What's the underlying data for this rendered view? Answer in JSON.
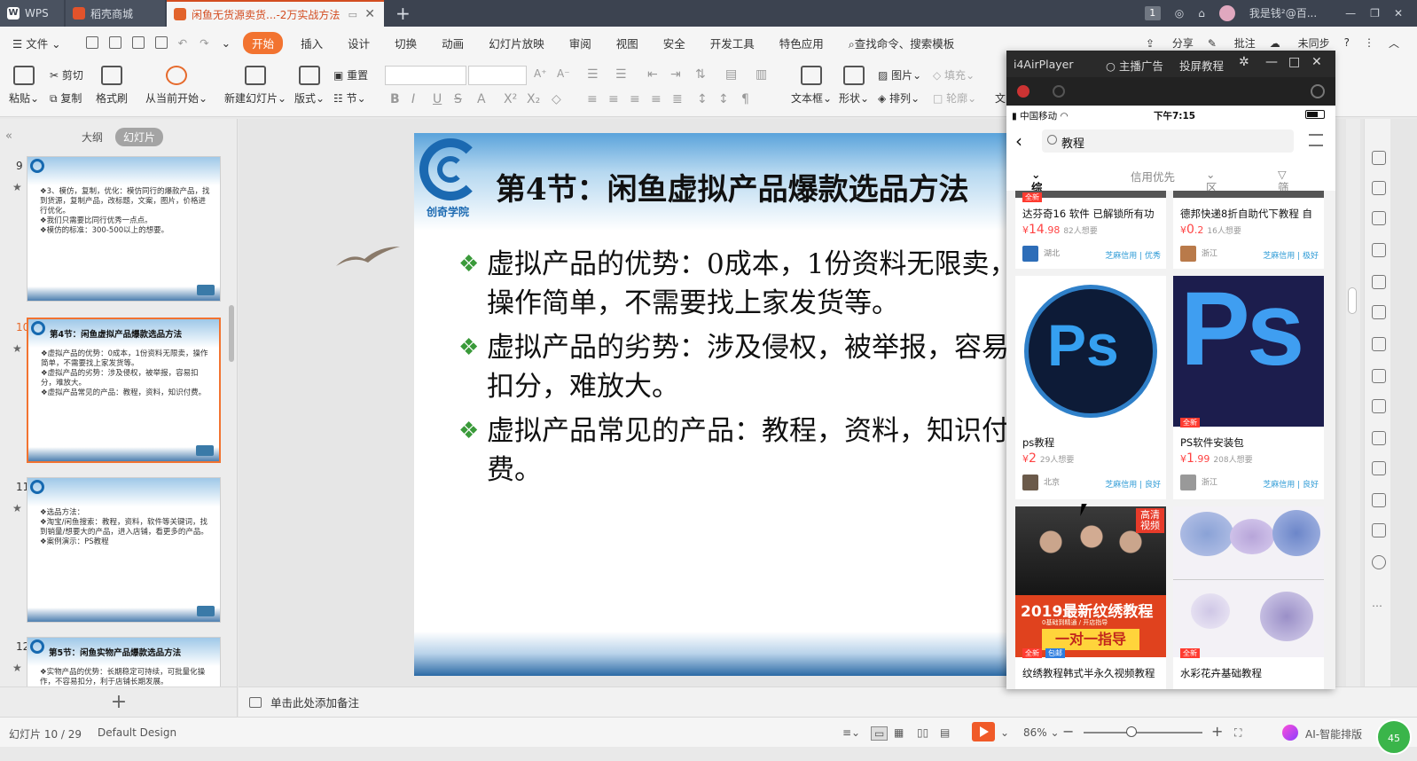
{
  "tabs": {
    "wps": "WPS",
    "store": "稻壳商城",
    "doc": "闲鱼无货源卖货...-2万实战方法",
    "count": "1",
    "user": "我是钱²@百..."
  },
  "menu": {
    "file": "文件",
    "items": [
      "开始",
      "插入",
      "设计",
      "切换",
      "动画",
      "幻灯片放映",
      "审阅",
      "视图",
      "安全",
      "开发工具",
      "特色应用"
    ],
    "search": "查找命令、搜索模板",
    "share": "分享",
    "annotate": "批注",
    "sync": "未同步"
  },
  "ribbon": {
    "paste": "粘贴",
    "cut": "剪切",
    "copy": "复制",
    "format_brush": "格式刷",
    "from_current": "从当前开始",
    "new_slide": "新建幻灯片",
    "layout": "版式",
    "reset": "重置",
    "section": "节",
    "textbox": "文本框",
    "shape": "形状",
    "picture": "图片",
    "arrange": "排列",
    "fill": "填充",
    "outline": "轮廓",
    "text_label": "文"
  },
  "left_panel": {
    "tab_outline": "大纲",
    "tab_slides": "幻灯片",
    "thumbs": [
      {
        "num": "9",
        "title": "",
        "lines": [
          "❖3、模仿，复制，优化：模仿同行的爆款产品，找到货源，复制产品，改标题，文案，图片，价格进行优化。",
          "❖我们只需要比同行优秀一点点。",
          "❖模仿的标准：300-500以上的想要。"
        ]
      },
      {
        "num": "10",
        "title": "第4节：闲鱼虚拟产品爆款选品方法",
        "lines": [
          "❖虚拟产品的优势：0成本，1份资料无限卖，操作简单，不需要找上家发货等。",
          "❖虚拟产品的劣势：涉及侵权，被举报，容易扣分，难放大。",
          "❖虚拟产品常见的产品：教程，资料，知识付费。"
        ]
      },
      {
        "num": "11",
        "title": "",
        "lines": [
          "❖选品方法：",
          "❖淘宝/闲鱼搜索：教程，资料，软件等关键词，找到销量/想要大的产品，进入店铺，看更多的产品。",
          "❖案例演示：PS教程"
        ]
      },
      {
        "num": "12",
        "title": "第5节：闲鱼实物产品爆款选品方法",
        "lines": [
          "❖实物产品的优势：长期稳定可持续，可批量化操作，不容易扣分，利于店铺长期发展。"
        ]
      }
    ]
  },
  "slide": {
    "logo_text": "创奇学院",
    "title": "第4节：闲鱼虚拟产品爆款选品方法",
    "bullets": [
      "虚拟产品的优势：0成本，1份资料无限卖，操作简单，不需要找上家发货等。",
      "虚拟产品的劣势：涉及侵权，被举报，容易扣分，难放大。",
      "虚拟产品常见的产品：教程，资料，知识付费。"
    ]
  },
  "notes": {
    "placeholder": "单击此处添加备注"
  },
  "status": {
    "slide_pos": "幻灯片 10 / 29",
    "theme": "Default Design",
    "zoom": "86%",
    "ai": "AI-智能排版",
    "badge": "45"
  },
  "airplayer": {
    "title": "i4AirPlayer",
    "live_ad": "主播广告",
    "tutorial": "投屏教程",
    "phone": {
      "carrier": "中国移动",
      "time": "下午7:15",
      "search_query": "教程",
      "filters": [
        "综合排序",
        "信用优先",
        "区域",
        "筛选"
      ],
      "items": [
        {
          "title": "达芬奇16 软件 已解锁所有功",
          "price_int": "14",
          "price_dec": ".98",
          "want": "82人想要",
          "region": "湖北",
          "credit": "芝麻信用 | 优秀"
        },
        {
          "title": "德邦快递8折自助代下教程 自",
          "price_int": "0",
          "price_dec": ".2",
          "want": "16人想要",
          "region": "浙江",
          "credit": "芝麻信用 | 极好"
        },
        {
          "title": "ps教程",
          "price_int": "2",
          "price_dec": "",
          "want": "29人想要",
          "region": "北京",
          "credit": "芝麻信用 | 良好",
          "logo": "Ps"
        },
        {
          "title": "PS软件安装包",
          "price_int": "1",
          "price_dec": ".99",
          "want": "208人想要",
          "region": "浙江",
          "credit": "芝麻信用 | 良好",
          "logo": "Ps",
          "tag": "全新"
        },
        {
          "title": "纹绣教程韩式半永久视频教程",
          "banner_title": "2019最新纹绣教程",
          "banner_sub": "0基础到精通 / 开店指导",
          "banner_cta": "一对一指导",
          "hd": "高清视频",
          "tags": [
            "全新",
            "包邮"
          ]
        },
        {
          "title": "水彩花卉基础教程",
          "tag": "全新"
        }
      ],
      "currency": "¥",
      "new_tag": "全新"
    }
  }
}
